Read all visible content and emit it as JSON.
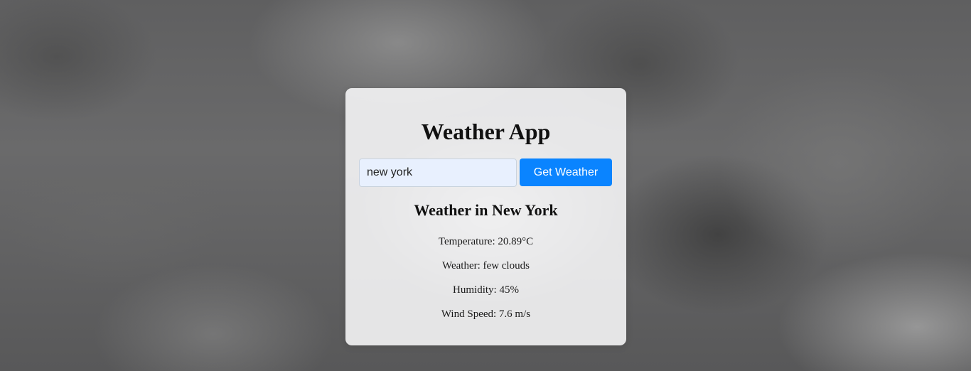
{
  "app": {
    "title": "Weather App"
  },
  "search": {
    "value": "new york",
    "button_label": "Get Weather"
  },
  "result": {
    "heading": "Weather in New York",
    "temperature": "Temperature: 20.89°C",
    "description": "Weather: few clouds",
    "humidity": "Humidity: 45%",
    "wind_speed": "Wind Speed: 7.6 m/s"
  },
  "colors": {
    "accent": "#0a84ff",
    "input_background": "#e8f0fe",
    "card_background": "#f8f8f9"
  }
}
